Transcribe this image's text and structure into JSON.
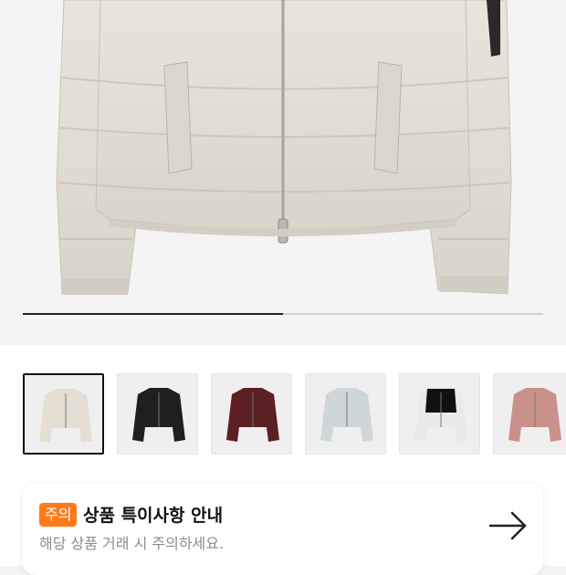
{
  "gallery": {
    "progress": 0.5,
    "active_index": 0
  },
  "thumbnails": [
    {
      "color": "#e4ded3",
      "accent": "#e4ded3"
    },
    {
      "color": "#1f1f1f",
      "accent": "#1f1f1f"
    },
    {
      "color": "#5c1f22",
      "accent": "#5c1f22"
    },
    {
      "color": "#cfd6da",
      "accent": "#cfd6da"
    },
    {
      "color": "#e8eaea",
      "accent": "#111111"
    },
    {
      "color": "#c9918a",
      "accent": "#c9918a"
    }
  ],
  "notice": {
    "badge": "주의",
    "title": "상품 특이사항 안내",
    "subtitle": "해당 상품 거래 시 주의하세요.",
    "arrow_icon": "arrow-right-icon"
  }
}
